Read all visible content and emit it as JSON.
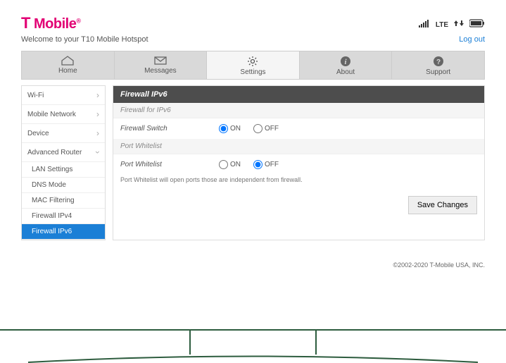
{
  "header": {
    "logo_prefix": "T",
    "logo_text": " Mobile",
    "welcome": "Welcome to your T10 Mobile Hotspot",
    "logout": "Log out",
    "lte_label": "LTE"
  },
  "nav": {
    "home": "Home",
    "messages": "Messages",
    "settings": "Settings",
    "about": "About",
    "support": "Support"
  },
  "sidebar": {
    "wifi": "Wi-Fi",
    "mobile_network": "Mobile Network",
    "device": "Device",
    "advanced_router": "Advanced Router",
    "lan_settings": "LAN Settings",
    "dns_mode": "DNS Mode",
    "mac_filtering": "MAC Filtering",
    "firewall_ipv4": "Firewall IPv4",
    "firewall_ipv6": "Firewall IPv6"
  },
  "panel": {
    "title": "Firewall IPv6",
    "section_firewall": "Firewall for IPv6",
    "firewall_switch_label": "Firewall Switch",
    "section_portwl": "Port Whitelist",
    "port_whitelist_label": "Port Whitelist",
    "note": "Port Whitelist will open ports those are independent from firewall.",
    "on": "ON",
    "off": "OFF",
    "save": "Save Changes"
  },
  "footer": {
    "copyright": "©2002-2020 T-Mobile USA, INC."
  },
  "state": {
    "firewall_switch": "on",
    "port_whitelist": "off"
  }
}
